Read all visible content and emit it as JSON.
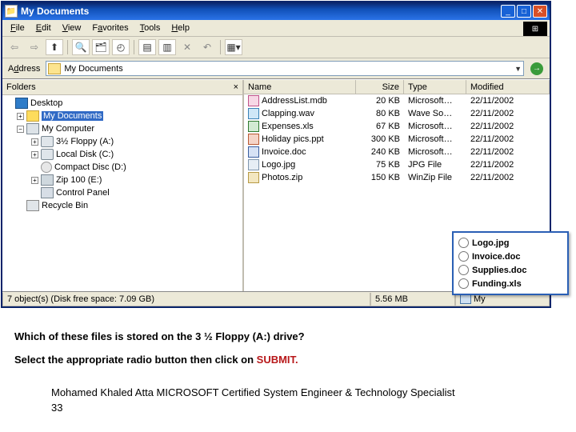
{
  "window": {
    "title": "My Documents",
    "menubar": [
      "File",
      "Edit",
      "View",
      "Favorites",
      "Tools",
      "Help"
    ],
    "address_label": "Address",
    "address_value": "My Documents"
  },
  "folders": {
    "header": "Folders",
    "tree": {
      "root": "Desktop",
      "my_documents": "My Documents",
      "my_computer": "My Computer",
      "floppy": "3½ Floppy (A:)",
      "localdisk": "Local Disk (C:)",
      "cd": "Compact Disc (D:)",
      "zip": "Zip 100 (E:)",
      "control_panel": "Control Panel",
      "recycle": "Recycle Bin"
    }
  },
  "columns": {
    "name": "Name",
    "size": "Size",
    "type": "Type",
    "modified": "Modified"
  },
  "files": [
    {
      "name": "AddressList.mdb",
      "size": "20 KB",
      "type": "Microsoft…",
      "mod": "22/11/2002",
      "kind": "mdb"
    },
    {
      "name": "Clapping.wav",
      "size": "80 KB",
      "type": "Wave So…",
      "mod": "22/11/2002",
      "kind": "wav"
    },
    {
      "name": "Expenses.xls",
      "size": "67 KB",
      "type": "Microsoft…",
      "mod": "22/11/2002",
      "kind": "xls"
    },
    {
      "name": "Holiday pics.ppt",
      "size": "300 KB",
      "type": "Microsoft…",
      "mod": "22/11/2002",
      "kind": "ppt"
    },
    {
      "name": "Invoice.doc",
      "size": "240 KB",
      "type": "Microsoft…",
      "mod": "22/11/2002",
      "kind": "doc"
    },
    {
      "name": "Logo.jpg",
      "size": "75 KB",
      "type": "JPG File",
      "mod": "22/11/2002",
      "kind": "jpg"
    },
    {
      "name": "Photos.zip",
      "size": "150 KB",
      "type": "WinZip File",
      "mod": "22/11/2002",
      "kind": "zipf"
    }
  ],
  "status": {
    "objects": "7 object(s) (Disk free space: 7.09 GB)",
    "totalsize": "5.56 MB",
    "location": "My"
  },
  "popup_options": [
    "Logo.jpg",
    "Invoice.doc",
    "Supplies.doc",
    "Funding.xls"
  ],
  "question": {
    "line1": "Which of these files is stored on the 3 ½ Floppy (A:) drive?",
    "line2_a": "Select the appropriate radio button then click on ",
    "line2_b": "SUBMIT."
  },
  "footer": {
    "text": "Mohamed Khaled Atta MICROSOFT Certified System Engineer & Technology Specialist",
    "page": "33"
  }
}
